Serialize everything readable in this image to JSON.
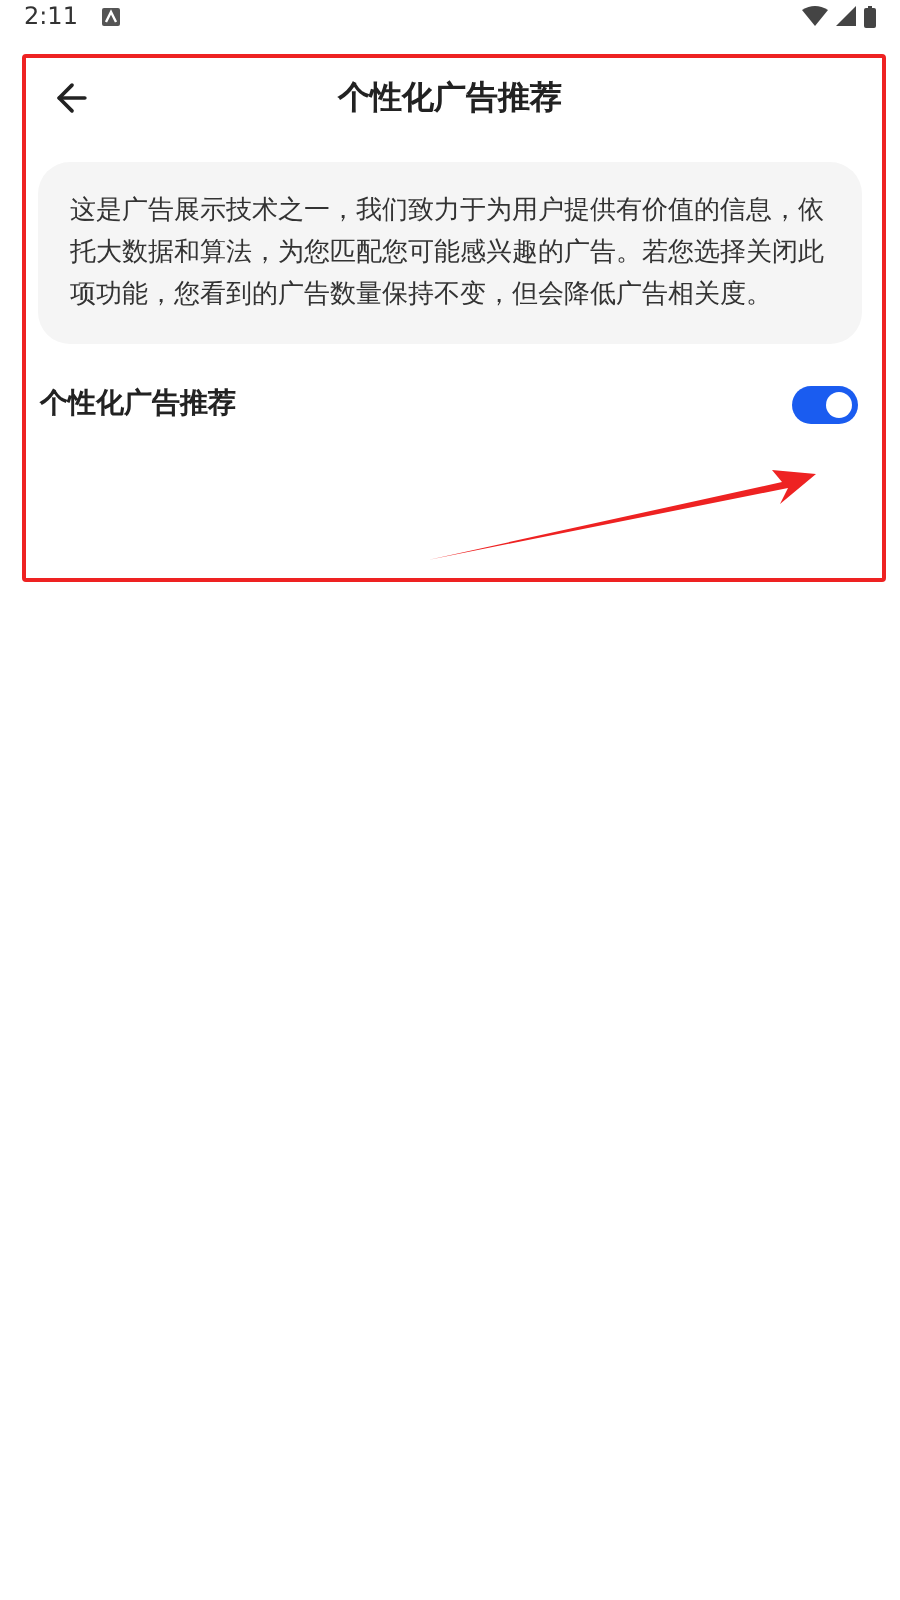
{
  "status_bar": {
    "time": "2:11"
  },
  "header": {
    "title": "个性化广告推荐"
  },
  "description": "这是广告展示技术之一，我们致力于为用户提供有价值的信息，依托大数据和算法，为您匹配您可能感兴趣的广告。若您选择关闭此项功能，您看到的广告数量保持不变，但会降低广告相关度。",
  "setting": {
    "label": "个性化广告推荐",
    "on": true
  }
}
